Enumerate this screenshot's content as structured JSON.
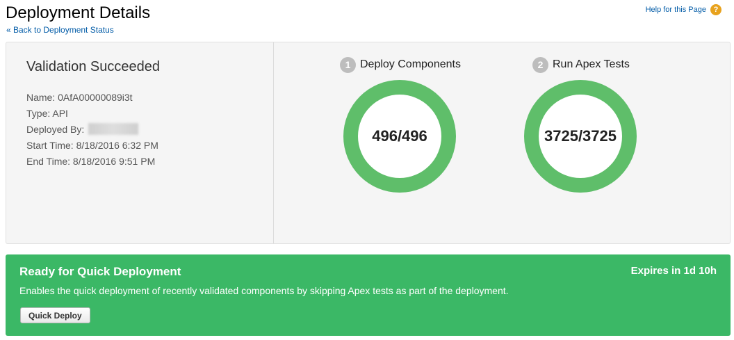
{
  "header": {
    "title": "Deployment Details",
    "back_link": "« Back to Deployment Status",
    "help_link": "Help for this Page",
    "help_icon": "question-icon"
  },
  "details": {
    "status_title": "Validation Succeeded",
    "rows": [
      {
        "label": "Name:",
        "value": "0AfA00000089i3t"
      },
      {
        "label": "Type:",
        "value": "API"
      },
      {
        "label": "Deployed By:",
        "value": ""
      },
      {
        "label": "Start Time:",
        "value": "8/18/2016 6:32 PM"
      },
      {
        "label": "End Time:",
        "value": "8/18/2016 9:51 PM"
      }
    ]
  },
  "steps": [
    {
      "number": "1",
      "label": "Deploy Components",
      "progress_text": "496/496",
      "completed": 496,
      "total": 496
    },
    {
      "number": "2",
      "label": "Run Apex Tests",
      "progress_text": "3725/3725",
      "completed": 3725,
      "total": 3725
    }
  ],
  "quick_deploy": {
    "title": "Ready for Quick Deployment",
    "expires": "Expires in 1d 10h",
    "description": "Enables the quick deployment of recently validated components by skipping Apex tests as part of the deployment.",
    "button_label": "Quick Deploy"
  },
  "colors": {
    "progress_ring": "#5fbe6a",
    "quick_panel": "#3bb866",
    "link": "#015ba7",
    "help_icon": "#e8a21d"
  }
}
